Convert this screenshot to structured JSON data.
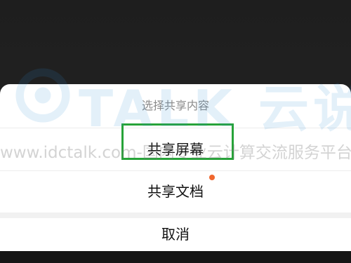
{
  "share_sheet": {
    "title": "选择共享内容",
    "options": [
      {
        "label": "共享屏幕",
        "highlighted": true
      },
      {
        "label": "共享文档",
        "has_notification_dot": true
      }
    ],
    "cancel_label": "取消"
  },
  "watermark": {
    "brand": "TALK 云说",
    "url_text": "www.idctalk.com-国内专业云计算交流服务平台"
  },
  "colors": {
    "highlight_border": "#27a339",
    "notification_dot": "#f0672e",
    "watermark_blue": "#2f8fd6"
  }
}
